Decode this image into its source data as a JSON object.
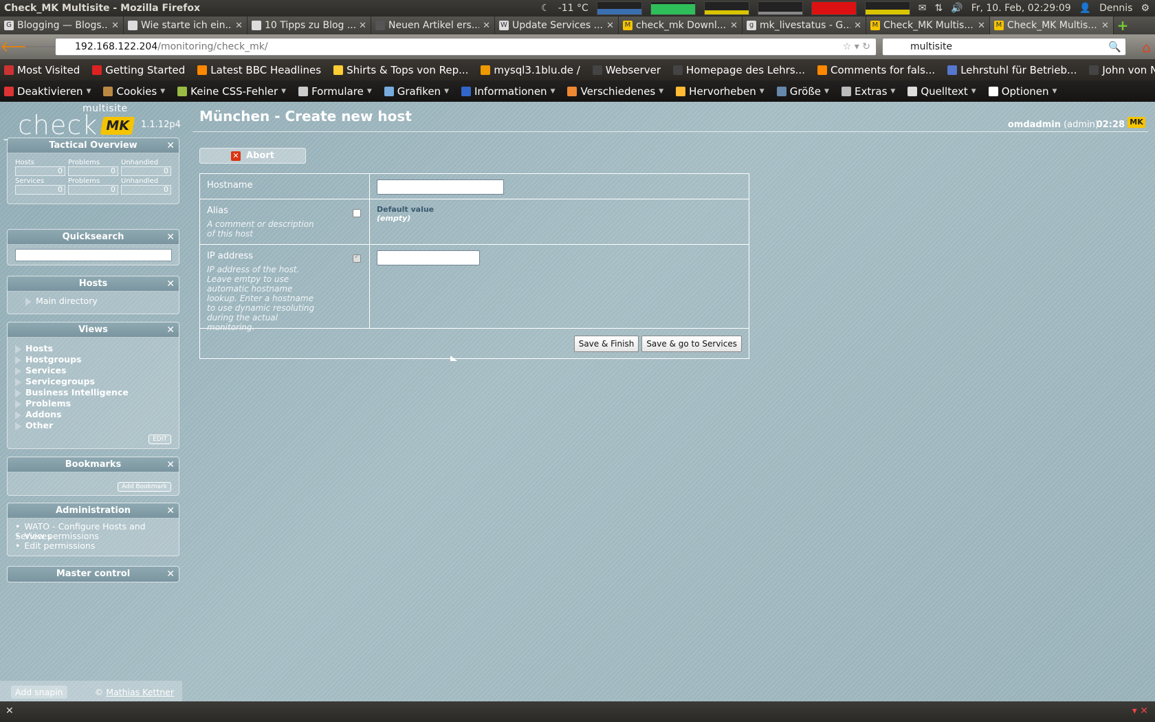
{
  "window": {
    "title": "Check_MK Multisite - Mozilla Firefox"
  },
  "tray": {
    "weather": "-11 °C",
    "datetime": "Fr, 10. Feb, 02:29:09",
    "user": "Dennis"
  },
  "tabs": [
    {
      "label": "Blogging — Blogs..."
    },
    {
      "label": "Wie starte ich ein..."
    },
    {
      "label": "10 Tipps zu Blog ..."
    },
    {
      "label": "Neuen Artikel ers..."
    },
    {
      "label": "Update Services ..."
    },
    {
      "label": "check_mk Downl..."
    },
    {
      "label": "mk_livestatus - G..."
    },
    {
      "label": "Check_MK Multis..."
    },
    {
      "label": "Check_MK Multis..."
    }
  ],
  "url": {
    "host": "192.168.122.204",
    "path": "/monitoring/check_mk/"
  },
  "search": {
    "value": "multisite"
  },
  "bookmarks": [
    {
      "label": "Most Visited",
      "color": "#c33"
    },
    {
      "label": "Getting Started",
      "color": "#d22"
    },
    {
      "label": "Latest BBC Headlines",
      "color": "#f80"
    },
    {
      "label": "Shirts & Tops von Rep...",
      "color": "#fc3"
    },
    {
      "label": "mysql3.1blu.de /",
      "color": "#e90"
    },
    {
      "label": "Webserver",
      "color": "#444"
    },
    {
      "label": "Homepage des Lehrs...",
      "color": "#444"
    },
    {
      "label": "Comments for fals...",
      "color": "#f80"
    },
    {
      "label": "Lehrstuhl für Betrieb...",
      "color": "#57c"
    },
    {
      "label": "John von Neumann un...",
      "color": "#444"
    }
  ],
  "webdev": [
    {
      "label": "Deaktivieren",
      "color": "#d33"
    },
    {
      "label": "Cookies",
      "color": "#b84"
    },
    {
      "label": "Keine CSS-Fehler",
      "color": "#9b4"
    },
    {
      "label": "Formulare",
      "color": "#ccc"
    },
    {
      "label": "Grafiken",
      "color": "#7ad"
    },
    {
      "label": "Informationen",
      "color": "#36c"
    },
    {
      "label": "Verschiedenes",
      "color": "#e83"
    },
    {
      "label": "Hervorheben",
      "color": "#fb3"
    },
    {
      "label": "Größe",
      "color": "#68a"
    },
    {
      "label": "Extras",
      "color": "#bbb"
    },
    {
      "label": "Quelltext",
      "color": "#ddd"
    },
    {
      "label": "Optionen",
      "color": "#fff"
    }
  ],
  "logo": {
    "multisite": "multisite",
    "check": "_check_",
    "mk": "MK",
    "version": "1.1.12p4"
  },
  "tactical": {
    "title": "Tactical Overview",
    "hosts_label": "Hosts",
    "problems_label": "Problems",
    "unhandled_label": "Unhandled",
    "services_label": "Services",
    "hosts": "0",
    "hosts_problems": "0",
    "hosts_unhandled": "0",
    "services": "0",
    "services_problems": "0",
    "services_unhandled": "0"
  },
  "quicksearch": {
    "title": "Quicksearch"
  },
  "hosts_snapin": {
    "title": "Hosts",
    "item": "Main directory"
  },
  "views": {
    "title": "Views",
    "items": [
      "Hosts",
      "Hostgroups",
      "Services",
      "Servicegroups",
      "Business Intelligence",
      "Problems",
      "Addons",
      "Other"
    ],
    "edit": "EDIT"
  },
  "bookmarks_snapin": {
    "title": "Bookmarks",
    "add": "Add Bookmark"
  },
  "administration": {
    "title": "Administration",
    "items": [
      "WATO - Configure Hosts and Services",
      "View permissions",
      "Edit permissions"
    ]
  },
  "master_control": {
    "title": "Master control"
  },
  "sidebar_footer": {
    "add_snapin": "Add snapin",
    "copyright": "©",
    "author": "Mathias Kettner"
  },
  "main": {
    "title": "München - Create new host",
    "user": "omdadmin",
    "role": "(admin)",
    "time": "02:28",
    "abort": "Abort"
  },
  "form": {
    "hostname_label": "Hostname",
    "alias_label": "Alias",
    "alias_help": "A comment or description of this host",
    "default_value": "Default value",
    "empty": "(empty)",
    "ip_label": "IP address",
    "ip_help": "IP address of the host. Leave emtpy to use automatic hostname lookup. Enter a hostname to use dynamic resoluting during the actual monitoring.",
    "save_finish": "Save & Finish",
    "save_services": "Save & go to Services"
  }
}
